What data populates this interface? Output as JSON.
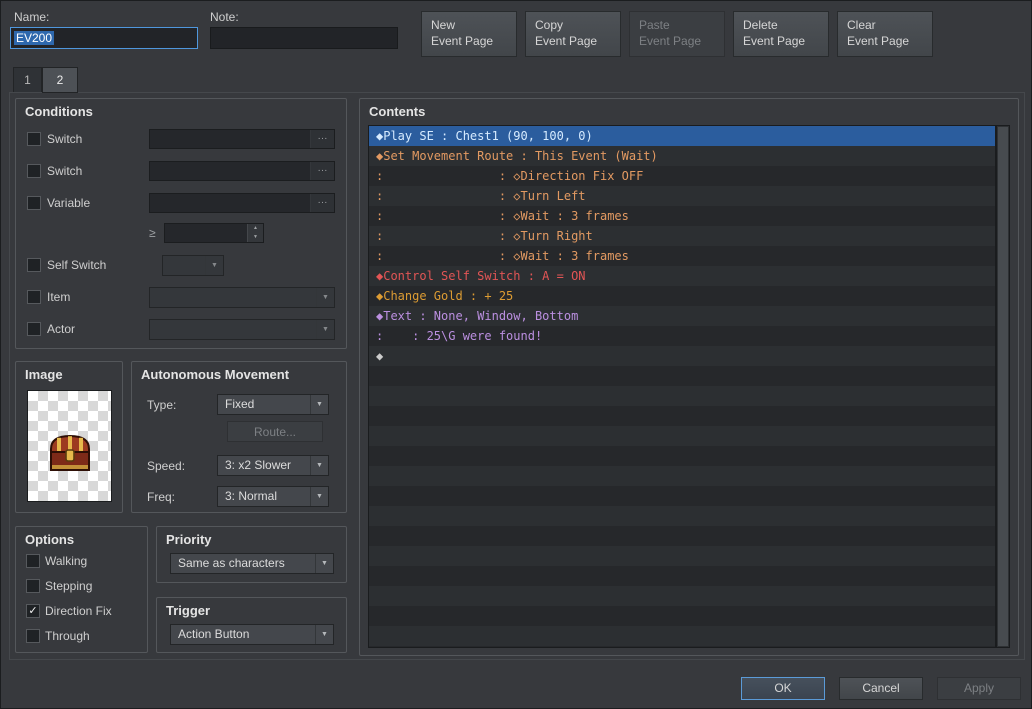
{
  "header": {
    "name_label": "Name:",
    "name_value": "EV200",
    "note_label": "Note:",
    "note_value": "",
    "buttons": {
      "new": "New\nEvent Page",
      "copy": "Copy\nEvent Page",
      "paste": "Paste\nEvent Page",
      "delete": "Delete\nEvent Page",
      "clear": "Clear\nEvent Page"
    }
  },
  "tabs": {
    "tab1": "1",
    "tab2": "2"
  },
  "conditions": {
    "title": "Conditions",
    "switch1_label": "Switch",
    "switch2_label": "Switch",
    "variable_label": "Variable",
    "gte_symbol": "≥",
    "self_switch_label": "Self Switch",
    "item_label": "Item",
    "actor_label": "Actor"
  },
  "image_box": {
    "title": "Image"
  },
  "autonomous_movement": {
    "title": "Autonomous Movement",
    "type_label": "Type:",
    "type_value": "Fixed",
    "route_button": "Route...",
    "speed_label": "Speed:",
    "speed_value": "3: x2 Slower",
    "freq_label": "Freq:",
    "freq_value": "3: Normal"
  },
  "options": {
    "title": "Options",
    "walking": "Walking",
    "stepping": "Stepping",
    "direction_fix": "Direction Fix",
    "through": "Through",
    "direction_fix_checked": true
  },
  "priority": {
    "title": "Priority",
    "value": "Same as characters"
  },
  "trigger": {
    "title": "Trigger",
    "value": "Action Button"
  },
  "contents": {
    "title": "Contents",
    "selection_color": "#2b5d9e",
    "lines": [
      {
        "text": "◆Play SE : Chest1 (90, 100, 0)",
        "color": "#d6ebff",
        "selected": true
      },
      {
        "text": "◆Set Movement Route : This Event (Wait)",
        "color": "#e39a62",
        "selected": false
      },
      {
        "text": ":                : ◇Direction Fix OFF",
        "color": "#e39a62",
        "selected": false
      },
      {
        "text": ":                : ◇Turn Left",
        "color": "#e39a62",
        "selected": false
      },
      {
        "text": ":                : ◇Wait : 3 frames",
        "color": "#e39a62",
        "selected": false
      },
      {
        "text": ":                : ◇Turn Right",
        "color": "#e39a62",
        "selected": false
      },
      {
        "text": ":                : ◇Wait : 3 frames",
        "color": "#e39a62",
        "selected": false
      },
      {
        "text": "◆Control Self Switch : A = ON",
        "color": "#e25555",
        "selected": false
      },
      {
        "text": "◆Change Gold : + 25",
        "color": "#dd9c33",
        "selected": false
      },
      {
        "text": "◆Text : None, Window, Bottom",
        "color": "#bb8fe0",
        "selected": false
      },
      {
        "text": ":    : 25\\G were found!",
        "color": "#bb8fe0",
        "selected": false
      },
      {
        "text": "◆",
        "color": "#cccccc",
        "selected": false
      }
    ]
  },
  "footer": {
    "ok": "OK",
    "cancel": "Cancel",
    "apply": "Apply"
  },
  "icons": {
    "dropdown_arrow": "▼",
    "ellipsis": "···",
    "check": "✓",
    "spinner_up": "▲",
    "spinner_down": "▼"
  }
}
